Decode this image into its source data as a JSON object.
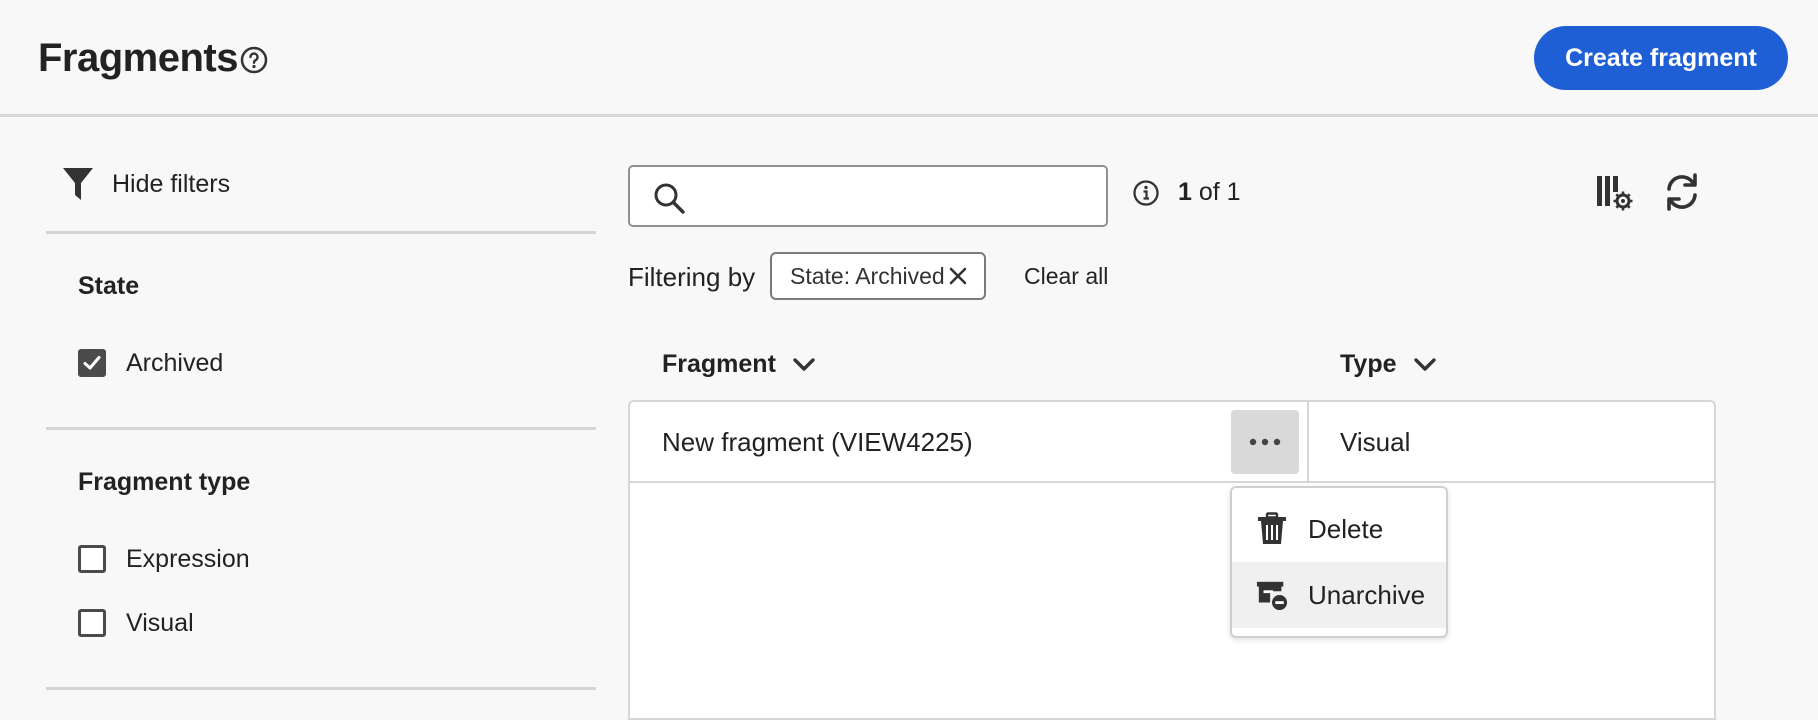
{
  "header": {
    "title": "Fragments",
    "create_button": "Create fragment"
  },
  "filters": {
    "hide_filters_label": "Hide filters",
    "state": {
      "title": "State",
      "options": [
        {
          "label": "Archived",
          "checked": true
        }
      ]
    },
    "fragment_type": {
      "title": "Fragment type",
      "options": [
        {
          "label": "Expression",
          "checked": false
        },
        {
          "label": "Visual",
          "checked": false
        }
      ]
    }
  },
  "search": {
    "value": "",
    "placeholder": ""
  },
  "results": {
    "current": "1",
    "of_label": "of 1"
  },
  "filtering": {
    "label": "Filtering by",
    "chip": "State: Archived",
    "clear_all": "Clear all"
  },
  "table": {
    "columns": [
      "Fragment",
      "Type"
    ],
    "rows": [
      {
        "fragment": "New fragment (VIEW4225)",
        "type": "Visual"
      }
    ]
  },
  "context_menu": {
    "items": [
      {
        "label": "Delete",
        "icon": "trash-icon"
      },
      {
        "label": "Unarchive",
        "icon": "unarchive-icon"
      }
    ]
  },
  "colors": {
    "accent": "#1f5fd6"
  }
}
